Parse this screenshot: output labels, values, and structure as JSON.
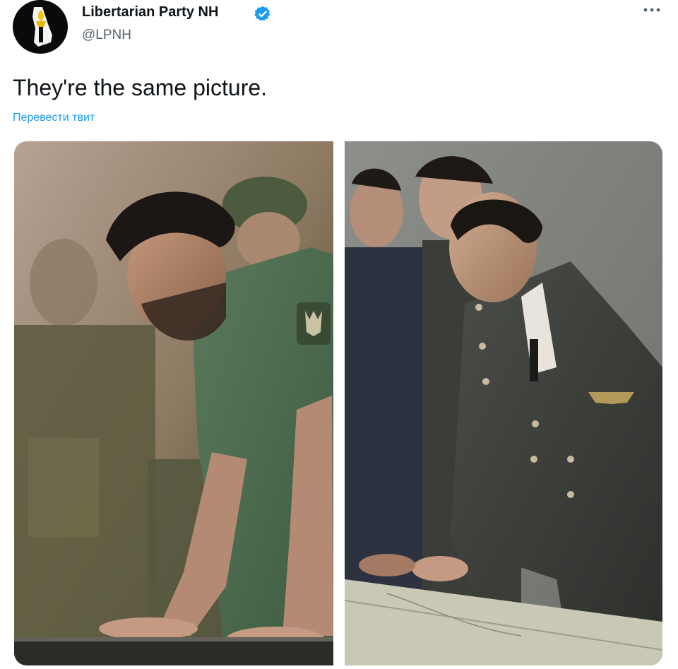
{
  "author": {
    "display_name": "Libertarian Party NH",
    "handle": "@LPNH",
    "verified": true,
    "avatar_icon": "torch-state-logo-icon"
  },
  "tweet": {
    "text": "They're the same picture.",
    "translate_label": "Перевести твит"
  },
  "actions": {
    "more_icon": "more-options-icon"
  },
  "media": {
    "photos": [
      {
        "description_icon": "photo-left"
      },
      {
        "description_icon": "photo-right"
      }
    ]
  },
  "colors": {
    "link": "#1d9bf0",
    "verified": "#1d9bf0",
    "secondary_text": "#536471",
    "primary_text": "#0f1419"
  }
}
